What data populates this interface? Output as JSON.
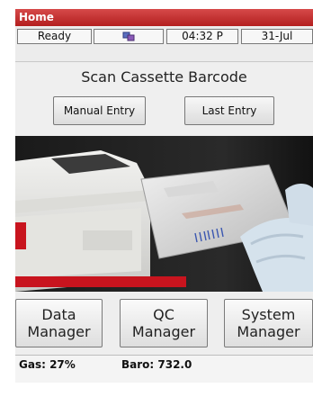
{
  "title": "Home",
  "status": {
    "ready": "Ready",
    "network_icon": "network-icon",
    "time": "04:32 P",
    "date": "31-Jul"
  },
  "main": {
    "heading": "Scan Cassette Barcode",
    "manual_entry": "Manual Entry",
    "last_entry": "Last Entry"
  },
  "managers": {
    "data": {
      "line1": "Data",
      "line2": "Manager"
    },
    "qc": {
      "line1": "QC",
      "line2": "Manager"
    },
    "system": {
      "line1": "System",
      "line2": "Manager"
    }
  },
  "footer": {
    "gas": "Gas: 27%",
    "baro": "Baro: 732.0"
  },
  "colors": {
    "title_bar": "#c03030",
    "accent_red": "#c8141e"
  }
}
